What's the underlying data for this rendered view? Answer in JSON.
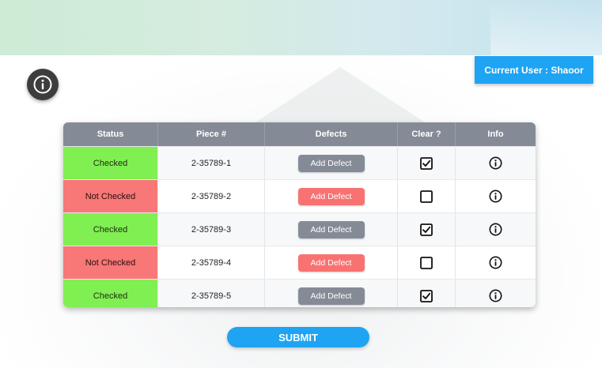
{
  "user": {
    "label": "Current User : Shaoor"
  },
  "table": {
    "headers": [
      "Status",
      "Piece #",
      "Defects",
      "Clear ?",
      "Info"
    ],
    "rows": [
      {
        "status": "Checked",
        "state": "checked",
        "piece": "2-35789-1",
        "defect_label": "Add Defect",
        "clear": true
      },
      {
        "status": "Not Checked",
        "state": "unchecked",
        "piece": "2-35789-2",
        "defect_label": "Add Defect",
        "clear": false
      },
      {
        "status": "Checked",
        "state": "checked",
        "piece": "2-35789-3",
        "defect_label": "Add Defect",
        "clear": true
      },
      {
        "status": "Not Checked",
        "state": "unchecked",
        "piece": "2-35789-4",
        "defect_label": "Add Defect",
        "clear": false
      },
      {
        "status": "Checked",
        "state": "checked",
        "piece": "2-35789-5",
        "defect_label": "Add Defect",
        "clear": true
      }
    ]
  },
  "submit": {
    "label": "SUBMIT"
  },
  "icons": {
    "help": "info-icon",
    "row_info": "info-icon",
    "clear": "checkbox-icon"
  },
  "colors": {
    "accent": "#1ea4f2",
    "checked": "#80ef52",
    "unchecked": "#f87777",
    "header": "#858b96"
  }
}
